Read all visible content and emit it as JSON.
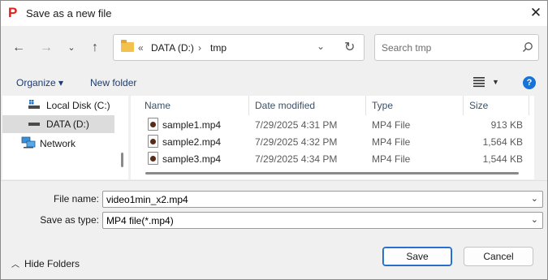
{
  "dialog": {
    "title": "Save as a new file",
    "app_icon_glyph": "P",
    "close_glyph": "✕"
  },
  "address": {
    "prefix": "«",
    "crumbs": [
      "DATA (D:)",
      "tmp"
    ],
    "separator": "›"
  },
  "search": {
    "placeholder": "Search tmp"
  },
  "toolbar": {
    "organize": "Organize ▾",
    "new_folder": "New folder",
    "help": "?"
  },
  "navpane": {
    "items": [
      {
        "label": "Local Disk (C:)",
        "icon": "drive-icon"
      },
      {
        "label": "DATA (D:)",
        "icon": "drive-icon",
        "selected": true
      },
      {
        "label": "Network",
        "icon": "network-icon"
      }
    ]
  },
  "filelist": {
    "columns": [
      "Name",
      "Date modified",
      "Type",
      "Size"
    ],
    "rows": [
      {
        "name": "sample1.mp4",
        "date": "7/29/2025 4:31 PM",
        "type": "MP4 File",
        "size": "913 KB"
      },
      {
        "name": "sample2.mp4",
        "date": "7/29/2025 4:32 PM",
        "type": "MP4 File",
        "size": "1,564 KB"
      },
      {
        "name": "sample3.mp4",
        "date": "7/29/2025 4:34 PM",
        "type": "MP4 File",
        "size": "1,544 KB"
      }
    ]
  },
  "form": {
    "file_name_label": "File name:",
    "file_name_value": "video1min_x2.mp4",
    "save_type_label": "Save as type:",
    "save_type_value": "MP4 file(*.mp4)"
  },
  "footer": {
    "hide_folders": "Hide Folders",
    "save": "Save",
    "cancel": "Cancel"
  },
  "colors": {
    "accent": "#1574d6",
    "app_icon": "#e0201b",
    "link_text": "#1f3b6e"
  }
}
